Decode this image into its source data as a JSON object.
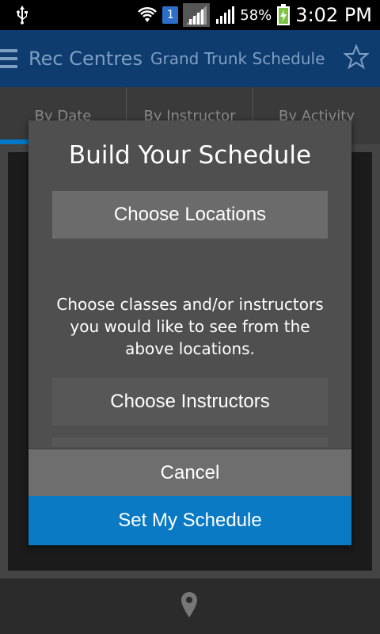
{
  "status_bar": {
    "sim_badge": "1",
    "battery_percent": "58%",
    "time": "3:02 PM",
    "icons": [
      "usb-icon",
      "wifi-icon",
      "sim-icon",
      "signal-icon",
      "signal-icon",
      "battery-charging-icon"
    ]
  },
  "app_bar": {
    "app_title": "Rec Centres",
    "screen_title": "Grand Trunk Schedule",
    "icons": [
      "menu-icon",
      "star-icon"
    ]
  },
  "tabs": [
    {
      "label": "By Date"
    },
    {
      "label": "By Instructor"
    },
    {
      "label": "By Activity"
    }
  ],
  "dialog": {
    "title": "Build Your Schedule",
    "choose_locations": "Choose Locations",
    "description": "Choose classes and/or instructors you would like to see from the above locations.",
    "choose_instructors": "Choose Instructors",
    "cancel": "Cancel",
    "set_schedule": "Set My Schedule"
  },
  "bottom_bar": {
    "icons": [
      "location-pin-icon"
    ]
  },
  "colors": {
    "app_bar": "#0f3c6e",
    "accent": "#0a7ac4",
    "dialog": "#4f4f4f"
  }
}
